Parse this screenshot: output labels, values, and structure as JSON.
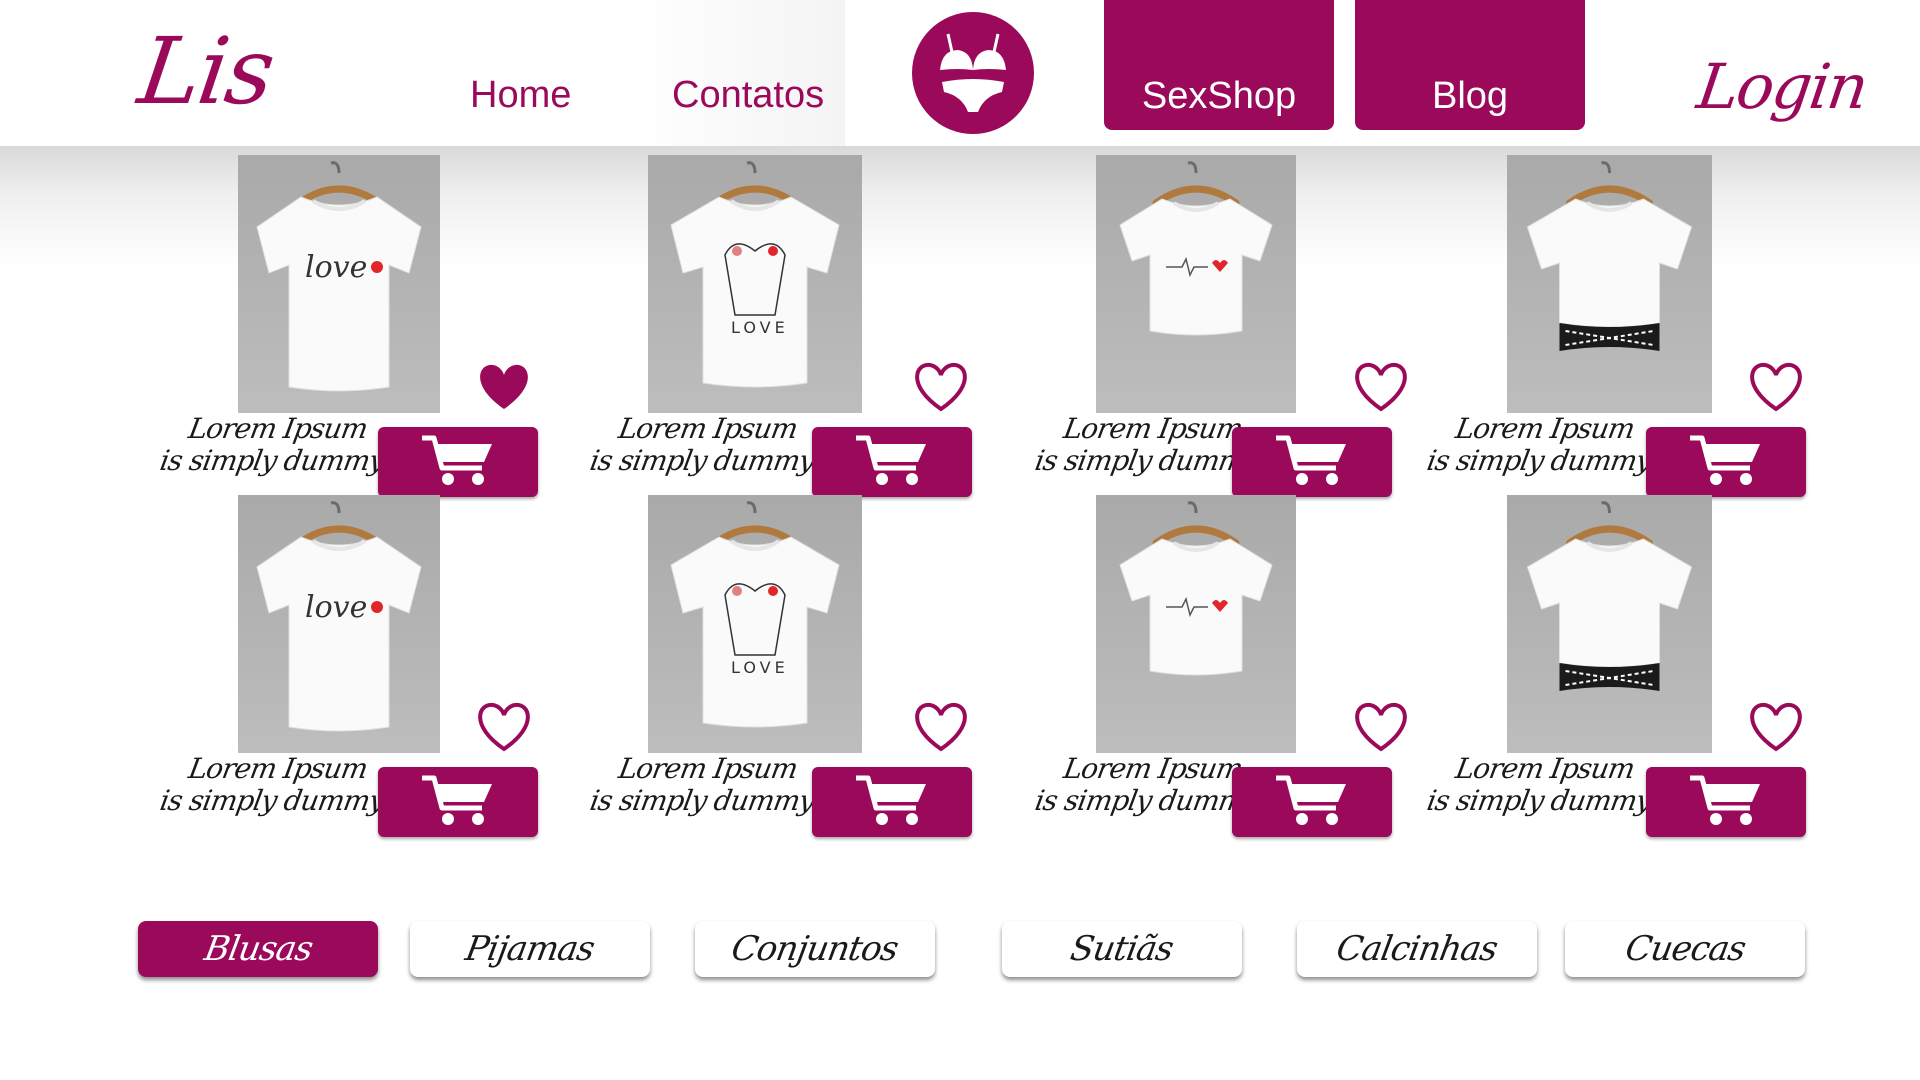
{
  "header": {
    "brand": "Lis",
    "login": "Login",
    "nav": {
      "home": "Home",
      "contatos": "Contatos",
      "sexshop": "SexShop",
      "blog": "Blog"
    },
    "logo_icon": "lingerie-icon"
  },
  "colors": {
    "accent": "#9b0a5a",
    "photo_bg": "#b3b3b3",
    "heart_red": "#e0262a"
  },
  "products": [
    {
      "caption_line1": "Lorem Ipsum",
      "caption_line2": "is simply dummy",
      "design": "love-script",
      "favorited": true
    },
    {
      "caption_line1": "Lorem Ipsum",
      "caption_line2": "is simply dummy",
      "design": "love-hands",
      "favorited": false
    },
    {
      "caption_line1": "Lorem Ipsum",
      "caption_line2": "is simply dummy",
      "design": "heartbeat-crop",
      "favorited": false
    },
    {
      "caption_line1": "Lorem Ipsum",
      "caption_line2": "is simply dummy",
      "design": "band-crop",
      "favorited": false
    },
    {
      "caption_line1": "Lorem Ipsum",
      "caption_line2": "is simply dummy",
      "design": "love-script",
      "favorited": false
    },
    {
      "caption_line1": "Lorem Ipsum",
      "caption_line2": "is simply dummy",
      "design": "love-hands",
      "favorited": false
    },
    {
      "caption_line1": "Lorem Ipsum",
      "caption_line2": "is simply dummy",
      "design": "heartbeat-crop",
      "favorited": false
    },
    {
      "caption_line1": "Lorem Ipsum",
      "caption_line2": "is simply dummy",
      "design": "band-crop",
      "favorited": false
    }
  ],
  "icons": {
    "cart": "shopping-cart-icon",
    "heart": "heart-icon"
  },
  "categories": [
    {
      "label": "Blusas",
      "active": true
    },
    {
      "label": "Pijamas",
      "active": false
    },
    {
      "label": "Conjuntos",
      "active": false
    },
    {
      "label": "Sutiãs",
      "active": false
    },
    {
      "label": "Calcinhas",
      "active": false
    },
    {
      "label": "Cuecas",
      "active": false
    }
  ]
}
